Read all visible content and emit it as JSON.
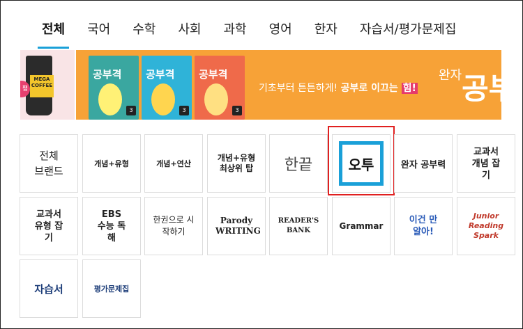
{
  "tabs": [
    "전체",
    "국어",
    "수학",
    "사회",
    "과학",
    "영어",
    "한자",
    "자습서/평가문제집"
  ],
  "banner": {
    "coffee_brand": "MEGA COFFEE",
    "coffee_badge": "평",
    "books": [
      {
        "title": "공부격",
        "grade": "3"
      },
      {
        "title": "공부격",
        "grade": "3"
      },
      {
        "title": "공부격",
        "grade": "3"
      }
    ],
    "slogan_pre": "기초부터 튼튼하게! ",
    "slogan_bold": "공부로 이끄는 ",
    "slogan_hl": "힘!",
    "brand_small": "완자",
    "brand_large": "공부"
  },
  "brands": [
    {
      "label": "전체\n브랜드"
    },
    {
      "label": "개념+유형"
    },
    {
      "label": "개념+연산"
    },
    {
      "label": "개념+유형 최상위 탑"
    },
    {
      "label": "한끝"
    },
    {
      "label": "오투"
    },
    {
      "label": "완자 공부력"
    },
    {
      "label": "교과서 개념 잡기"
    },
    {
      "label": "교과서 유형 잡기"
    },
    {
      "label": "EBS 수능 독해"
    },
    {
      "label": "한권으로 시작하기"
    },
    {
      "label": "Parody WRITING"
    },
    {
      "label": "READER'S BANK"
    },
    {
      "label": "Grammar"
    },
    {
      "label": "이건 만 알아!"
    },
    {
      "label": "Junior Reading Spark"
    },
    {
      "label": "자습서"
    },
    {
      "label": "평가문제집"
    }
  ],
  "colors": {
    "accent": "#1aa0d8",
    "banner_orange": "#f7a237",
    "highlight": "#e02020"
  }
}
